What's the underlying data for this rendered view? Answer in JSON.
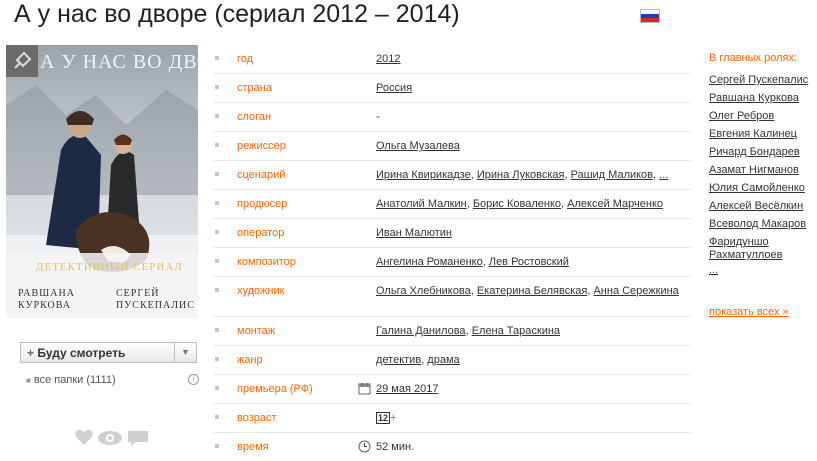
{
  "page": {
    "title": "А у нас во дворе (сериал 2012 – 2014)",
    "flag_colors": [
      "#ffffff",
      "#1c3fb8",
      "#d52b1e"
    ]
  },
  "poster": {
    "headline": "А У НАС ВО ДВОРЕ",
    "genre_tag": "ДЕТЕКТИВНЫЙ СЕРИАЛ",
    "actor_left": "РАВШАНА КУРКОВА",
    "actor_right": "СЕРГЕЙ ПУСКЕПАЛИС"
  },
  "watch": {
    "label": "Буду смотреть",
    "folders": "все папки (1111)"
  },
  "info": {
    "year": {
      "key": "год",
      "value": "2012"
    },
    "country": {
      "key": "страна",
      "value": "Россия"
    },
    "slogan": {
      "key": "слоган",
      "value": "-"
    },
    "director": {
      "key": "режиссер",
      "value": "Ольга Музалева"
    },
    "writer": {
      "key": "сценарий",
      "people": [
        "Ирина Квирикадзе",
        "Ирина Луковская",
        "Рашид Маликов"
      ],
      "more": "..."
    },
    "producer": {
      "key": "продюсер",
      "people": [
        "Анатолий Малкин",
        "Борис Коваленко",
        "Алексей Марченко"
      ]
    },
    "operator": {
      "key": "оператор",
      "value": "Иван Малютин"
    },
    "composer": {
      "key": "композитор",
      "people": [
        "Ангелина Романенко",
        "Лев Ростовский"
      ]
    },
    "artist": {
      "key": "художник",
      "people": [
        "Ольга Хлебникова",
        "Екатерина Белявская",
        "Анна Сережкина"
      ]
    },
    "editing": {
      "key": "монтаж",
      "people": [
        "Галина Данилова",
        "Елена Тараскина"
      ]
    },
    "genre": {
      "key": "жанр",
      "people": [
        "детектив",
        "драма"
      ]
    },
    "premiere": {
      "key": "премьера (РФ)",
      "value": "29 мая 2017"
    },
    "age": {
      "key": "возраст",
      "value": "12",
      "suffix": "+"
    },
    "time": {
      "key": "время",
      "value": "52 мин."
    }
  },
  "cast": {
    "header": "В главных ролях:",
    "actors": [
      "Сергей Пускепалис",
      "Равшана Куркова",
      "Олег Ребров",
      "Евгения Калинец",
      "Ричард Бондарев",
      "Азамат Нигманов",
      "Юлия Самойленко",
      "Алексей Весёлкин",
      "Всеволод Макаров",
      "Фаридуншо Рахматуллоев"
    ],
    "ellipsis": "...",
    "show_all": "показать всех »"
  }
}
